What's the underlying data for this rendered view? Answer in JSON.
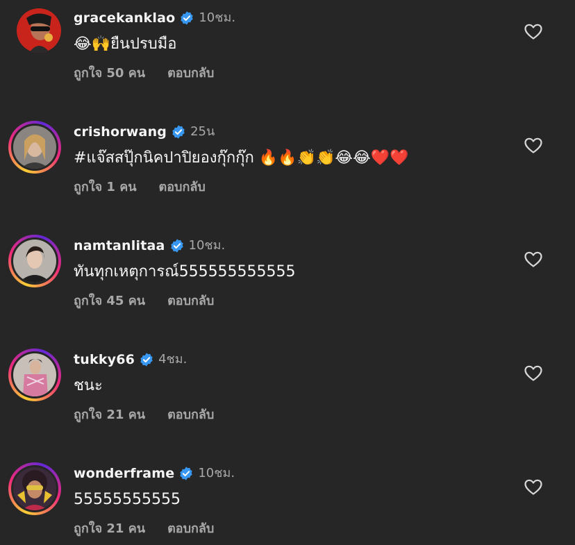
{
  "comments": [
    {
      "username": "gracekanklao",
      "time": "10ชม.",
      "text": "😂🙌ยืนปรบมือ",
      "likes": "ถูกใจ 50 คน",
      "reply": "ตอบกลับ"
    },
    {
      "username": "crishorwang",
      "time": "25น",
      "text": "#แจ๊สสปุ๊กนิคปาปิยองกุ๊กกุ๊ก 🔥🔥👏👏😂😂❤️❤️",
      "likes": "ถูกใจ 1 คน",
      "reply": "ตอบกลับ"
    },
    {
      "username": "namtanlitaa",
      "time": "10ชม.",
      "text": "ทันทุกเหตุการณ์555555555555",
      "likes": "ถูกใจ 45 คน",
      "reply": "ตอบกลับ"
    },
    {
      "username": "tukky66",
      "time": "4ชม.",
      "text": "ชนะ",
      "likes": "ถูกใจ 21 คน",
      "reply": "ตอบกลับ"
    },
    {
      "username": "wonderframe",
      "time": "10ชม.",
      "text": "55555555555",
      "likes": "ถูกใจ 21 คน",
      "reply": "ตอบกลับ"
    }
  ],
  "colors": {
    "background": "#262626",
    "text": "#f5f5f5",
    "secondary": "#a8a8a8",
    "verified": "#3897f0"
  }
}
